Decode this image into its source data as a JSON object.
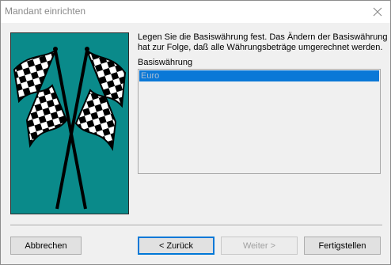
{
  "window": {
    "title": "Mandant einrichten"
  },
  "description": {
    "line1": "Legen Sie die Basiswährung fest. Das Ändern der Basiswährung",
    "line2": "hat zur Folge, daß alle Währungsbeträge umgerechnet werden."
  },
  "currency_list": {
    "label": "Basiswährung",
    "items": [
      {
        "label": "Euro",
        "selected": true
      }
    ]
  },
  "buttons": {
    "cancel": "Abbrechen",
    "back": "< Zurück",
    "next": "Weiter >",
    "finish": "Fertigstellen"
  },
  "colors": {
    "panel_background": "#0a8a8a",
    "selection": "#0a78d7"
  },
  "icons": {
    "close": "close-icon",
    "illustration": "checkered-flags-icon"
  }
}
